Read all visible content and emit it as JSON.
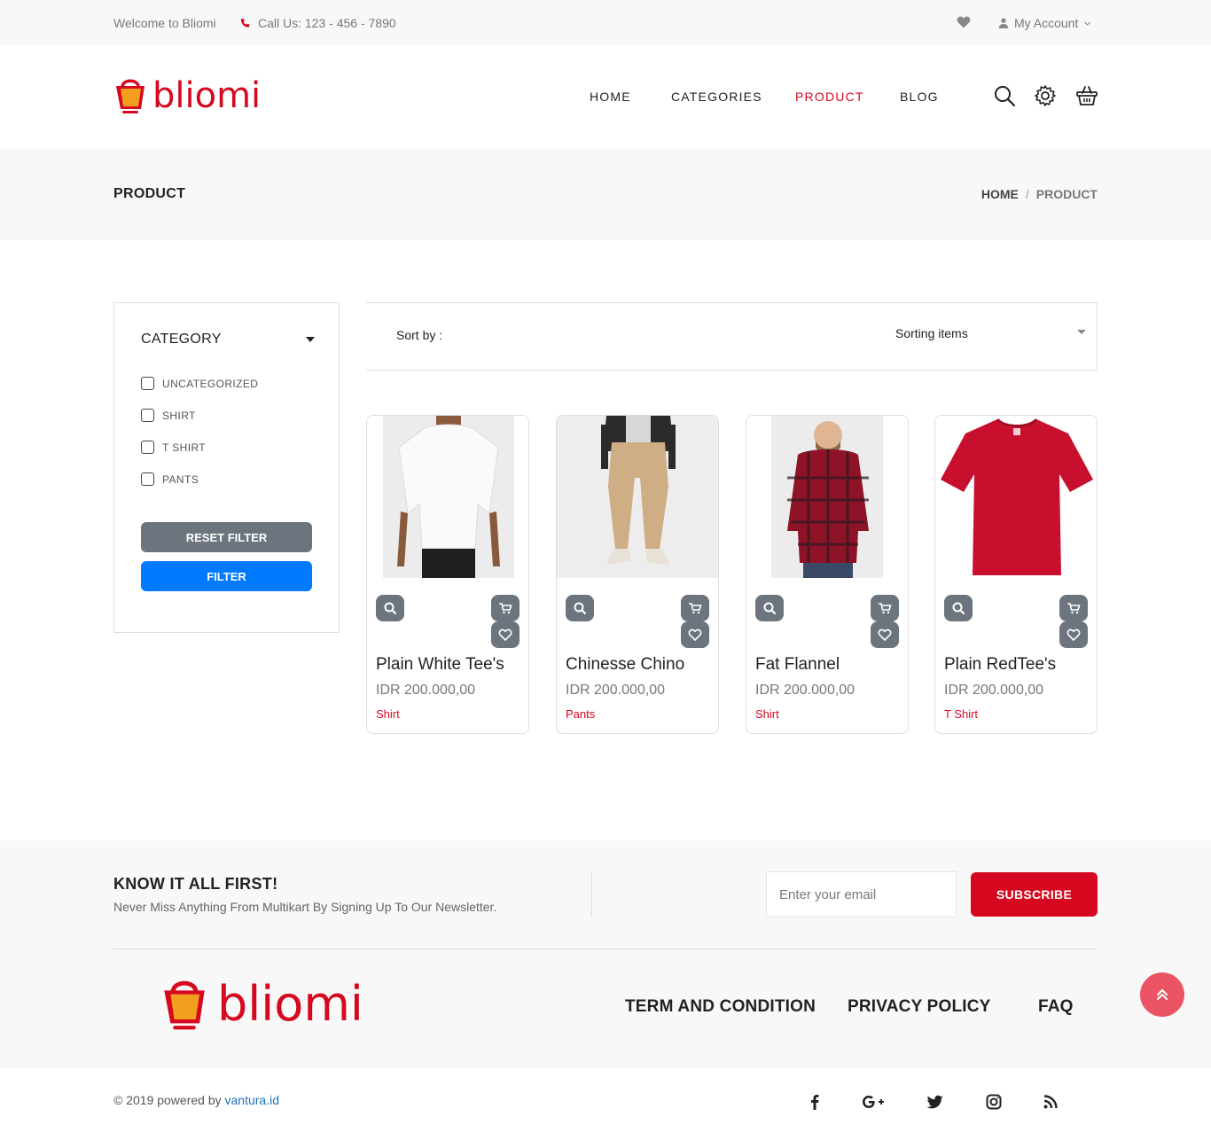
{
  "topbar": {
    "welcome": "Welcome to Bliomi",
    "call": "Call Us: 123 - 456 - 7890",
    "account": "My Account"
  },
  "brand": {
    "name": "bliomi",
    "color": "#d6081f"
  },
  "nav": {
    "items": [
      {
        "label": "HOME"
      },
      {
        "label": "CATEGORIES"
      },
      {
        "label": "PRODUCT"
      },
      {
        "label": "BLOG"
      }
    ],
    "active": "PRODUCT"
  },
  "page": {
    "title": "PRODUCT",
    "breadcrumb": [
      "HOME",
      "/",
      "PRODUCT"
    ]
  },
  "filters": {
    "heading": "CATEGORY",
    "options": [
      {
        "label": "UNCATEGORIZED",
        "checked": false
      },
      {
        "label": "SHIRT",
        "checked": false
      },
      {
        "label": "T SHIRT",
        "checked": false
      },
      {
        "label": "PANTS",
        "checked": false
      }
    ],
    "reset_label": "RESET FILTER",
    "filter_label": "FILTER"
  },
  "sort": {
    "label": "Sort by :",
    "selected": "Sorting items"
  },
  "products": [
    {
      "name": "Plain White Tee's",
      "price": "IDR 200.000,00",
      "category": "Shirt",
      "image": "white-tshirt-model"
    },
    {
      "name": "Chinesse Chino",
      "price": "IDR 200.000,00",
      "category": "Pants",
      "image": "chino-pants-model"
    },
    {
      "name": "Fat Flannel",
      "price": "IDR 200.000,00",
      "category": "Shirt",
      "image": "flannel-shirt-model"
    },
    {
      "name": "Plain RedTee's",
      "price": "IDR 200.000,00",
      "category": "T Shirt",
      "image": "red-tshirt"
    }
  ],
  "newsletter": {
    "heading": "KNOW IT ALL FIRST!",
    "subtext": "Never Miss Anything From Multikart By Signing Up To Our Newsletter.",
    "placeholder": "Enter your email",
    "button": "SUBSCRIBE"
  },
  "footer": {
    "links": [
      "TERM AND CONDITION",
      "PRIVACY POLICY",
      "FAQ"
    ],
    "copyright_prefix": "© 2019 powered by ",
    "copyright_link": "vantura.id",
    "social": [
      "facebook-icon",
      "google-plus-icon",
      "twitter-icon",
      "instagram-icon",
      "rss-icon"
    ]
  }
}
